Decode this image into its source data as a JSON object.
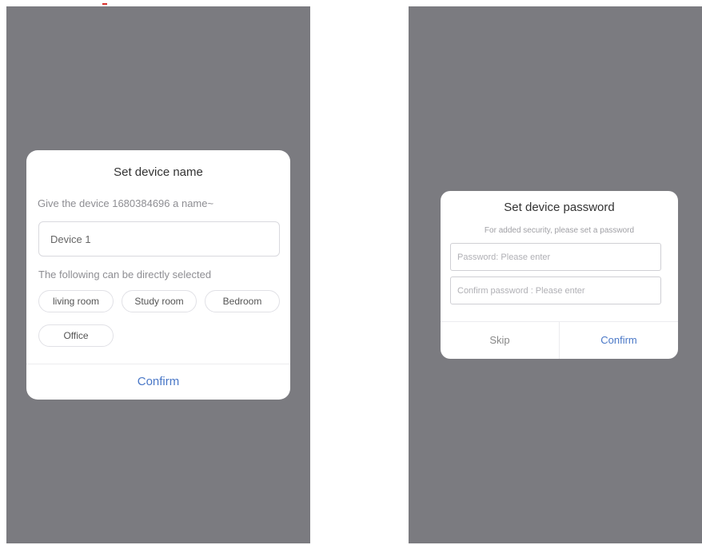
{
  "colors": {
    "overlay": "#7b7b80",
    "dialog_bg": "#ffffff",
    "accent": "#4a78c7",
    "muted_text": "#8e8e93"
  },
  "name_dialog": {
    "title": "Set device name",
    "subtitle": "Give the device 1680384696 a name~",
    "input_value": "Device 1",
    "hint": "The following can be directly selected",
    "chips": [
      "living room",
      "Study room",
      "Bedroom",
      "Office"
    ],
    "confirm_label": "Confirm"
  },
  "password_dialog": {
    "title": "Set device password",
    "subtitle": "For added security, please set a password",
    "password_placeholder": "Password: Please enter",
    "confirm_placeholder": "Confirm password : Please enter",
    "skip_label": "Skip",
    "confirm_label": "Confirm"
  }
}
